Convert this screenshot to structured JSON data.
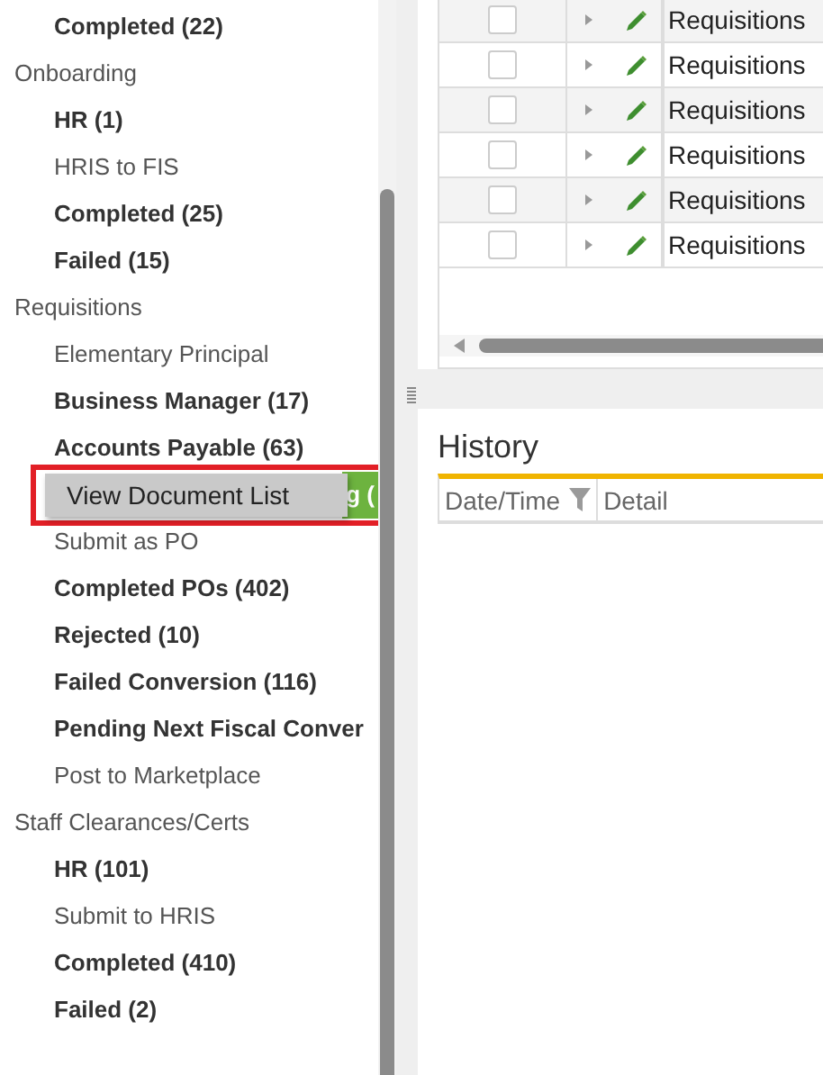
{
  "sidebar": {
    "groups": [
      {
        "children": [
          {
            "label": "Completed (22)",
            "bold": true
          }
        ]
      },
      {
        "label": "Onboarding",
        "children": [
          {
            "label": "HR (1)",
            "bold": true
          },
          {
            "label": "HRIS to FIS",
            "bold": false
          },
          {
            "label": "Completed (25)",
            "bold": true
          },
          {
            "label": "Failed (15)",
            "bold": true
          }
        ]
      },
      {
        "label": "Requisitions",
        "children": [
          {
            "label": "Elementary Principal",
            "bold": false
          },
          {
            "label": "Business Manager (17)",
            "bold": true
          },
          {
            "label": "Accounts Payable (63)",
            "bold": true
          },
          {
            "label": "g (",
            "bold": true,
            "selected": true
          },
          {
            "label": "Submit as PO",
            "bold": false
          },
          {
            "label": "Completed POs (402)",
            "bold": true
          },
          {
            "label": "Rejected (10)",
            "bold": true
          },
          {
            "label": "Failed Conversion (116)",
            "bold": true
          },
          {
            "label": "Pending Next Fiscal Conver",
            "bold": true
          },
          {
            "label": "Post to Marketplace",
            "bold": false
          }
        ]
      },
      {
        "label": "Staff Clearances/Certs",
        "children": [
          {
            "label": "HR (101)",
            "bold": true
          },
          {
            "label": "Submit to HRIS",
            "bold": false
          },
          {
            "label": "Completed (410)",
            "bold": true
          },
          {
            "label": "Failed (2)",
            "bold": true
          }
        ]
      }
    ]
  },
  "context_menu": {
    "items": [
      "View Document List"
    ]
  },
  "grid": {
    "rows": [
      {
        "checked": false,
        "type": "Requisitions"
      },
      {
        "checked": false,
        "type": "Requisitions"
      },
      {
        "checked": false,
        "type": "Requisitions"
      },
      {
        "checked": false,
        "type": "Requisitions"
      },
      {
        "checked": false,
        "type": "Requisitions"
      },
      {
        "checked": false,
        "type": "Requisitions"
      }
    ]
  },
  "history": {
    "title": "History",
    "columns": [
      {
        "label": "Date/Time",
        "filter": true
      },
      {
        "label": "Detail",
        "filter": false
      }
    ]
  }
}
